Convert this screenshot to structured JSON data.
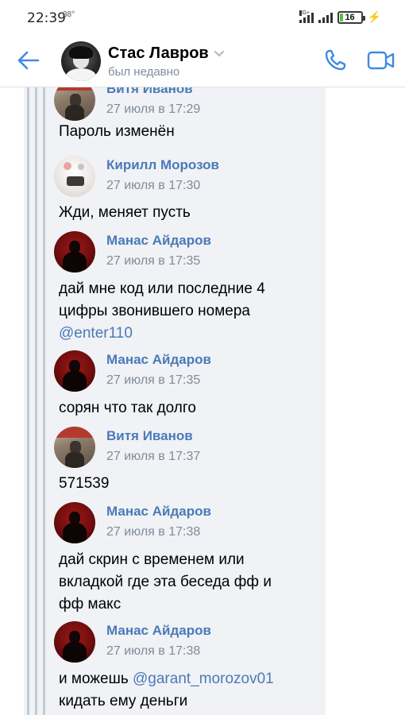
{
  "status_bar": {
    "time": "22:39",
    "temperature": "38°",
    "network": "4G+",
    "battery": "16",
    "battery_level": 0.16
  },
  "header": {
    "name": "Стас Лавров",
    "status": "был недавно"
  },
  "messages": [
    {
      "author": "Витя Иванов",
      "time": "27 июля в 17:29",
      "avatar": "vitya",
      "lines": [
        "Пароль изменён"
      ]
    },
    {
      "author": "Кирилл Морозов",
      "time": "27 июля в 17:30",
      "avatar": "kirill",
      "lines": [
        "Жди, меняет пусть"
      ]
    },
    {
      "author": "Манас Айдаров",
      "time": "27 июля в 17:35",
      "avatar": "manas",
      "lines": [
        "дай мне код или последние 4",
        "цифры звонившего номера"
      ],
      "mention": "@enter110"
    },
    {
      "author": "Манас Айдаров",
      "time": "27 июля в 17:35",
      "avatar": "manas",
      "lines": [
        "сорян что так долго"
      ]
    },
    {
      "author": "Витя Иванов",
      "time": "27 июля в 17:37",
      "avatar": "vitya",
      "lines": [
        "571539"
      ]
    },
    {
      "author": "Манас Айдаров",
      "time": "27 июля в 17:38",
      "avatar": "manas",
      "lines": [
        "дай скрин с временем или",
        "вкладкой где эта беседа фф и",
        "фф макс"
      ]
    },
    {
      "author": "Манас Айдаров",
      "time": "27 июля в 17:38",
      "avatar": "manas",
      "text_before_mention": "и можешь ",
      "mention": "@garant_morozov01",
      "lines_after": [
        "кидать ему деньги"
      ]
    }
  ]
}
